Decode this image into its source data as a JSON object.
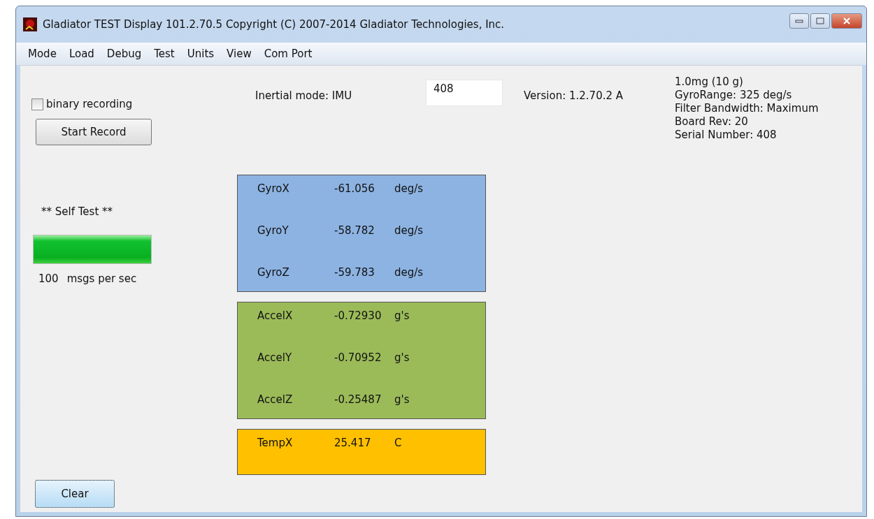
{
  "window": {
    "title": "Gladiator TEST Display 101.2.70.5  Copyright (C) 2007-2014 Gladiator Technologies, Inc."
  },
  "menu": [
    "Mode",
    "Load",
    "Debug",
    "Test",
    "Units",
    "View",
    "Com Port"
  ],
  "recording": {
    "label": "binary recording",
    "checked": false
  },
  "start_button": "Start Record",
  "self_test": {
    "label": "** Self Test **",
    "level": 1.0
  },
  "rate": {
    "value": "100",
    "unit": "msgs per sec"
  },
  "clear_button": "Clear",
  "inertial_mode": "Inertial mode: IMU",
  "serial_field": {
    "value": "408"
  },
  "version": "Version: 1.2.70.2 A",
  "info": [
    "1.0mg (10 g)",
    "GyroRange:  325 deg/s",
    "Filter Bandwidth: Maximum",
    "Board Rev: 20",
    "Serial Number: 408"
  ],
  "panels": [
    {
      "color": "#8db3e2",
      "rows": [
        {
          "label": "GyroX",
          "value": "-61.056",
          "unit": "deg/s"
        },
        {
          "label": "GyroY",
          "value": "-58.782",
          "unit": "deg/s"
        },
        {
          "label": "GyroZ",
          "value": "-59.783",
          "unit": "deg/s"
        }
      ]
    },
    {
      "color": "#9bbb59",
      "rows": [
        {
          "label": "AccelX",
          "value": "-0.72930",
          "unit": "g's"
        },
        {
          "label": "AccelY",
          "value": "-0.70952",
          "unit": "g's"
        },
        {
          "label": "AccelZ",
          "value": "-0.25487",
          "unit": "g's"
        }
      ]
    },
    {
      "color": "#ffc000",
      "rows": [
        {
          "label": "TempX",
          "value": "25.417",
          "unit": "C"
        }
      ]
    }
  ]
}
